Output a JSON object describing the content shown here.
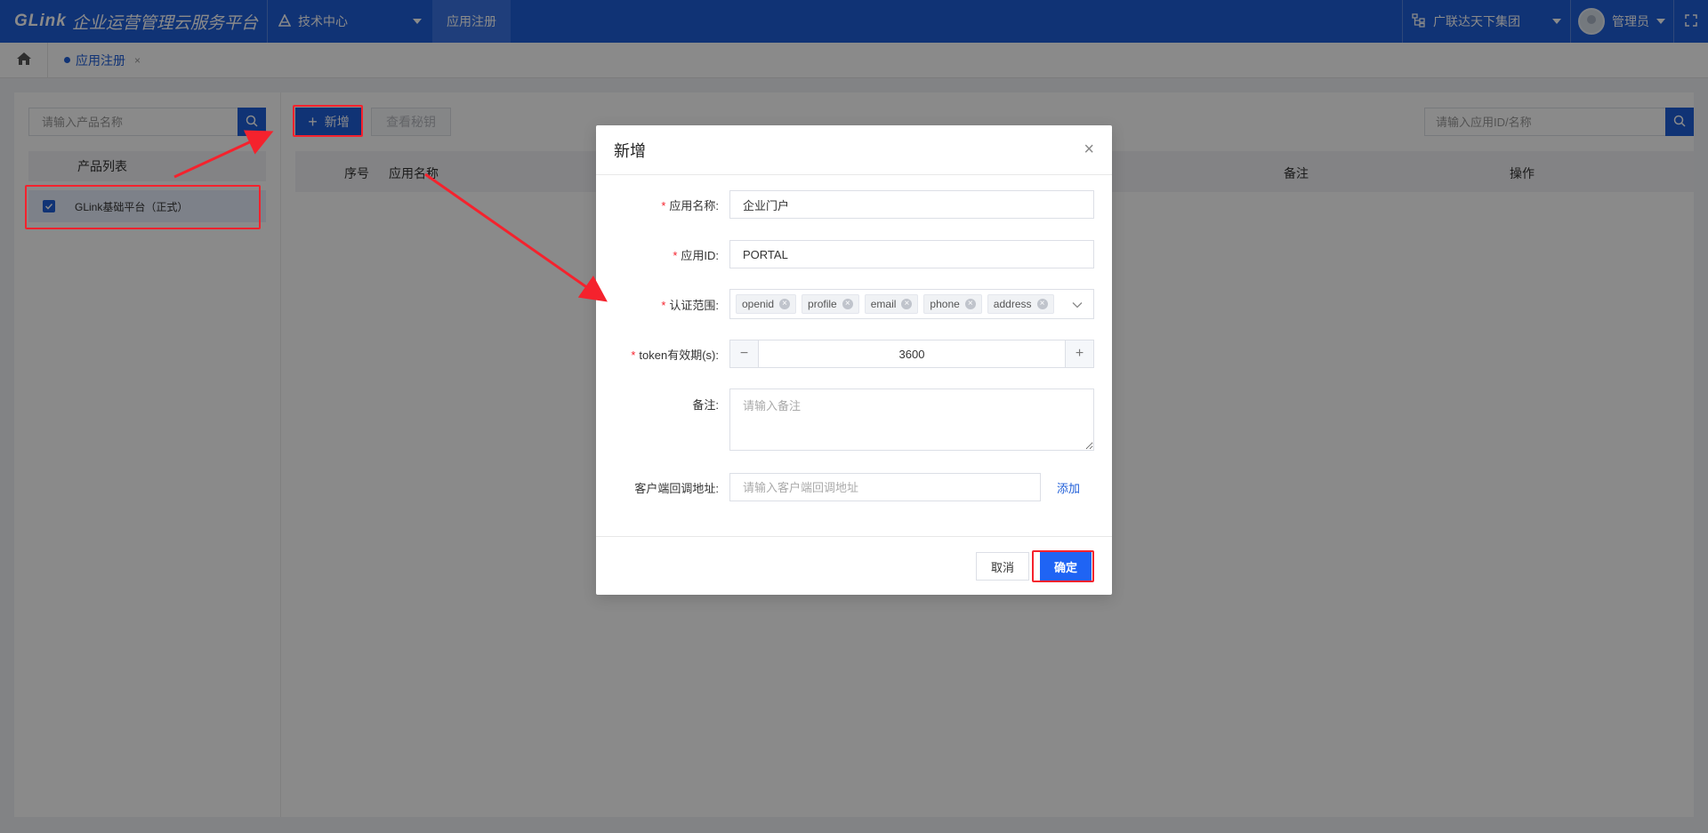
{
  "header": {
    "brand": "GLink",
    "platform_title": "企业运营管理云服务平台",
    "center": "技术中心",
    "active_nav": "应用注册",
    "org": "广联达天下集团",
    "user": "管理员"
  },
  "tabs": [
    {
      "label": "应用注册",
      "close": "×"
    }
  ],
  "left_panel": {
    "search_placeholder": "请输入产品名称",
    "list_header": "产品列表",
    "products": [
      {
        "name": "GLink基础平台（正式）",
        "checked": true
      }
    ]
  },
  "toolbar": {
    "add_label": "新增",
    "add_icon": "+",
    "view_secret_label": "查看秘钥",
    "app_search_placeholder": "请输入应用ID/名称"
  },
  "table": {
    "columns": [
      "序号",
      "应用名称",
      "备注",
      "操作"
    ]
  },
  "modal": {
    "title": "新增",
    "close": "×",
    "fields": {
      "app_name": {
        "label": "应用名称:",
        "value": "企业门户",
        "required": true
      },
      "app_id": {
        "label": "应用ID:",
        "value": "PORTAL",
        "required": true
      },
      "scope": {
        "label": "认证范围:",
        "tags": [
          "openid",
          "profile",
          "email",
          "phone",
          "address"
        ],
        "required": true
      },
      "token_ttl": {
        "label": "token有效期(s):",
        "value": "3600",
        "minus": "−",
        "plus": "+",
        "required": true
      },
      "remark": {
        "label": "备注:",
        "placeholder": "请输入备注"
      },
      "callback": {
        "label": "客户端回调地址:",
        "placeholder": "请输入客户端回调地址",
        "add": "添加"
      }
    },
    "cancel_label": "取消",
    "confirm_label": "确定"
  },
  "colors": {
    "primary": "#1f5ed8",
    "annotation": "#f5222d",
    "required": "#f5222d"
  }
}
